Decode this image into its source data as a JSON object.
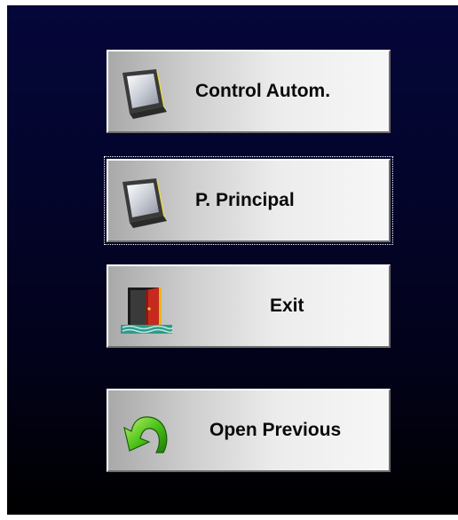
{
  "buttons": [
    {
      "label": "Control Autom.",
      "icon": "monitor-icon"
    },
    {
      "label": "P. Principal",
      "icon": "monitor-icon"
    },
    {
      "label": "Exit",
      "icon": "exit-door-icon"
    },
    {
      "label": "Open Previous",
      "icon": "back-arrow-icon"
    }
  ],
  "colors": {
    "background_top": "#05063a",
    "background_bottom": "#000000",
    "button_face_light": "#f7f7f7",
    "button_face_dark": "#a9a9a9",
    "label_text": "#0a0a0a"
  }
}
